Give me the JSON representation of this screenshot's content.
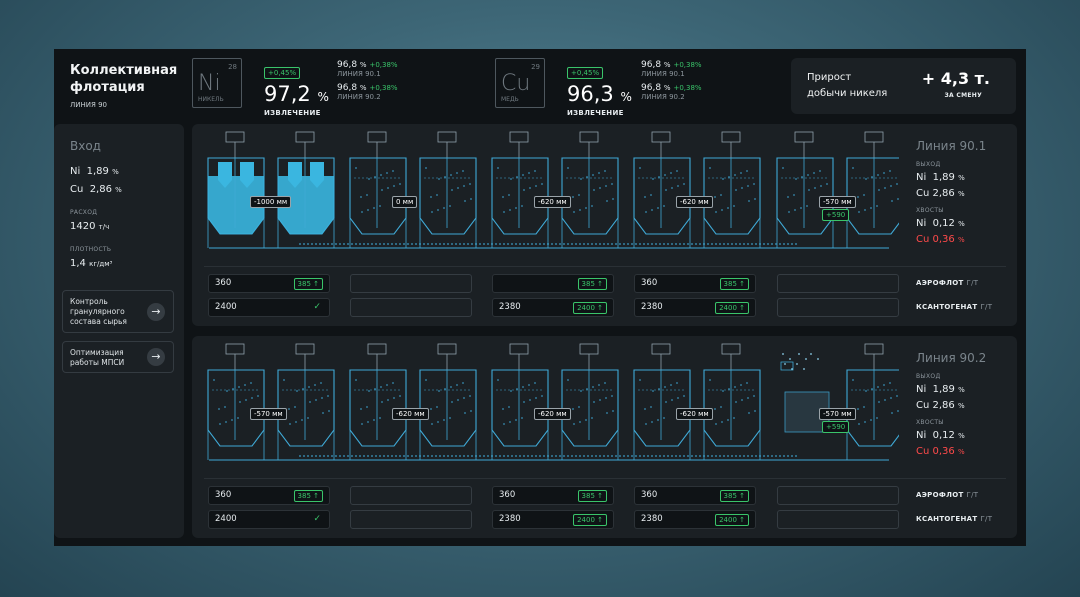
{
  "header": {
    "title_line1": "Коллективная",
    "title_line2": "флотация",
    "line": "ЛИНИЯ 90",
    "ni": {
      "number": "28",
      "symbol": "Ni",
      "name": "НИКЕЛЬ",
      "delta": "+0,45%",
      "value": "97,2",
      "unit": "%",
      "caption": "ИЗВЛЕЧЕНИЕ",
      "l1_value": "96,8",
      "l1_unit": "%",
      "l1_delta": "+0,38%",
      "l1_name": "ЛИНИЯ 90.1",
      "l2_value": "96,8",
      "l2_unit": "%",
      "l2_delta": "+0,38%",
      "l2_name": "ЛИНИЯ 90.2"
    },
    "cu": {
      "number": "29",
      "symbol": "Cu",
      "name": "МЕДЬ",
      "delta": "+0,45%",
      "value": "96,3",
      "unit": "%",
      "caption": "ИЗВЛЕЧЕНИЕ",
      "l1_value": "96,8",
      "l1_unit": "%",
      "l1_delta": "+0,38%",
      "l1_name": "ЛИНИЯ 90.1",
      "l2_value": "96,8",
      "l2_unit": "%",
      "l2_delta": "+0,38%",
      "l2_name": "ЛИНИЯ 90.2"
    },
    "gain": {
      "label_line1": "Прирост",
      "label_line2": "добычи никеля",
      "value": "+ 4,3 т.",
      "caption": "ЗА СМЕНУ"
    }
  },
  "sidebar": {
    "input_title": "Вход",
    "ni_label": "Ni",
    "ni_value": "1,89",
    "ni_unit": "%",
    "cu_label": "Cu",
    "cu_value": "2,86",
    "cu_unit": "%",
    "flow_caption": "РАСХОД",
    "flow_value": "1420",
    "flow_unit": "т/ч",
    "density_caption": "ПЛОТНОСТЬ",
    "density_value": "1,4",
    "density_unit": "кг/дм³",
    "btn1_line1": "Контроль",
    "btn1_line2": "гранулярного",
    "btn1_line3": "состава сырья",
    "btn2_line1": "Оптимизация",
    "btn2_line2": "работы МПСИ"
  },
  "lines": [
    {
      "title": "Линия 90.1",
      "out_caption": "ВЫХОД",
      "out_ni": "Ni",
      "out_ni_val": "1,89",
      "out_cu": "Cu",
      "out_cu_val": "2,86",
      "tail_caption": "ХВОСТЫ",
      "tail_ni": "Ni",
      "tail_ni_val": "0,12",
      "tail_cu": "Cu",
      "tail_cu_val": "0,36",
      "unit": "%",
      "levels": [
        "-1000 мм",
        "0 мм",
        "-620 мм",
        "-620 мм",
        "-570 мм"
      ],
      "level_extra": "+590",
      "aero": [
        {
          "value": "360",
          "tag": "385"
        },
        {
          "value": "",
          "tag": ""
        },
        {
          "value": "",
          "tag": "385"
        },
        {
          "value": "360",
          "tag": "385"
        },
        {
          "value": "",
          "tag": ""
        }
      ],
      "xant": [
        {
          "value": "2400",
          "tag": "check"
        },
        {
          "value": "",
          "tag": ""
        },
        {
          "value": "2380",
          "tag": "2400"
        },
        {
          "value": "2380",
          "tag": "2400"
        },
        {
          "value": "",
          "tag": ""
        }
      ]
    },
    {
      "title": "Линия 90.2",
      "out_caption": "ВЫХОД",
      "out_ni": "Ni",
      "out_ni_val": "1,89",
      "out_cu": "Cu",
      "out_cu_val": "2,86",
      "tail_caption": "ХВОСТЫ",
      "tail_ni": "Ni",
      "tail_ni_val": "0,12",
      "tail_cu": "Cu",
      "tail_cu_val": "0,36",
      "unit": "%",
      "levels": [
        "-570 мм",
        "-620 мм",
        "-620 мм",
        "-620 мм",
        "-570 мм"
      ],
      "level_extra": "+590",
      "aero": [
        {
          "value": "360",
          "tag": "385"
        },
        {
          "value": "",
          "tag": ""
        },
        {
          "value": "360",
          "tag": "385"
        },
        {
          "value": "360",
          "tag": "385"
        },
        {
          "value": "",
          "tag": ""
        }
      ],
      "xant": [
        {
          "value": "2400",
          "tag": "check"
        },
        {
          "value": "",
          "tag": ""
        },
        {
          "value": "2380",
          "tag": "2400"
        },
        {
          "value": "2380",
          "tag": "2400"
        },
        {
          "value": "",
          "tag": ""
        }
      ]
    }
  ],
  "row_labels": {
    "aero": "АЭРОФЛОТ",
    "aero_unit": "Г/Т",
    "xant": "КСАНТОГЕНАТ",
    "xant_unit": "Г/Т"
  },
  "colors": {
    "accent_green": "#3ac46a",
    "alert_red": "#ff4a4a",
    "tank_blue": "#3fa9d6",
    "tank_fill": "#3ab6e0"
  }
}
